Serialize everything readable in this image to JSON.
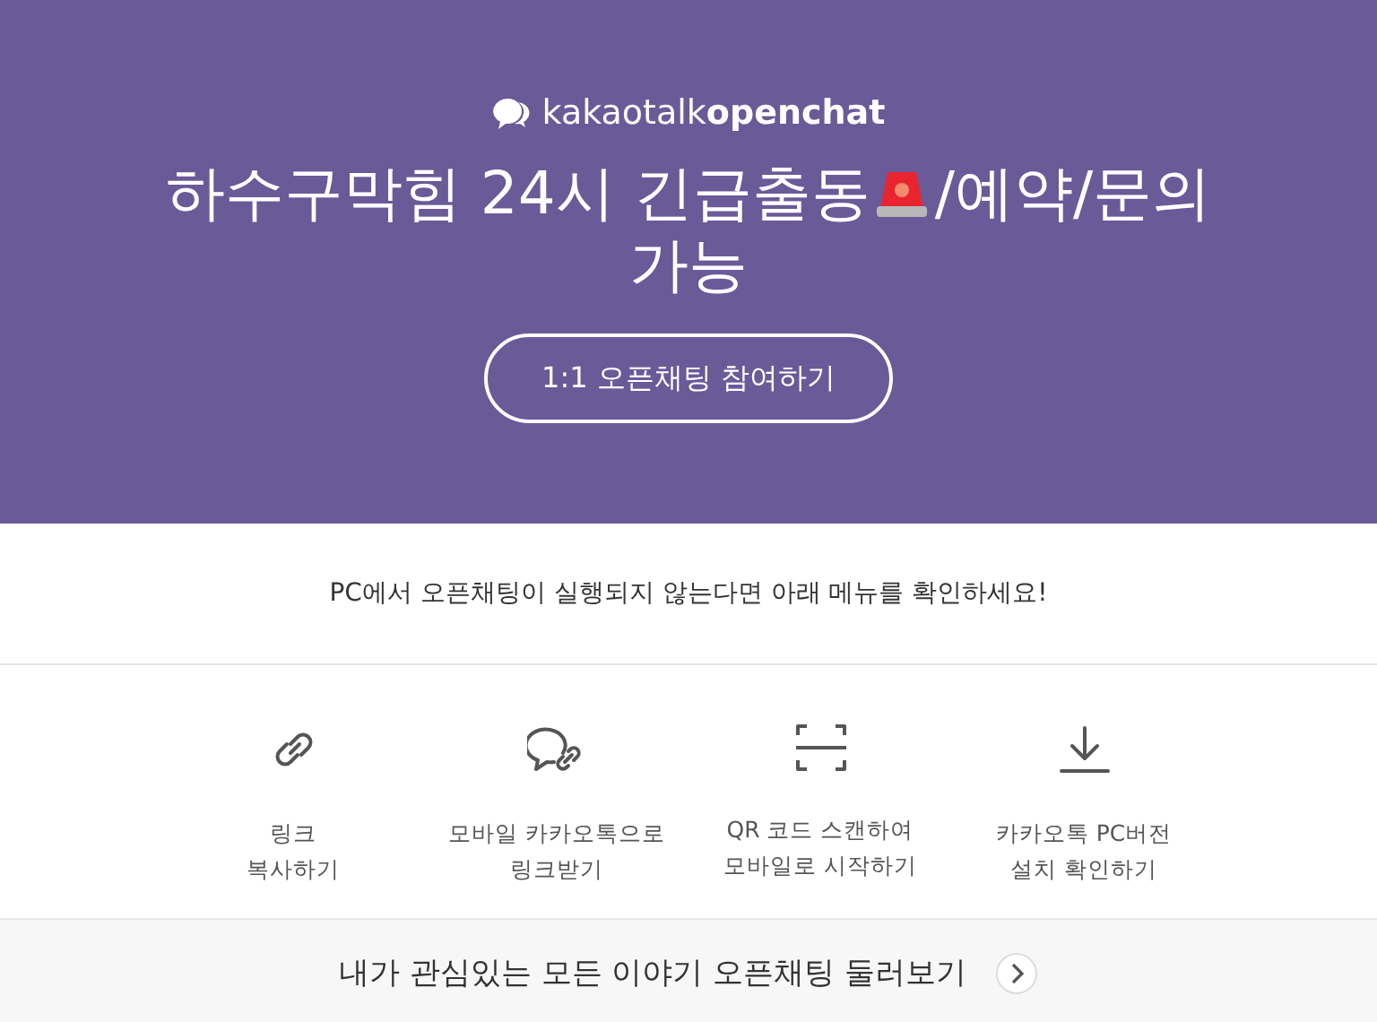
{
  "header": {
    "logo": "kakaotalk**openchat**",
    "title_before": "하수구막힘 24시 긴급출동",
    "title_after": "/예약/문의",
    "title_line2": "가능",
    "join_button": "1:1 오픈채팅 참여하기"
  },
  "notice": "PC에서 오픈채팅이 실행되지 않는다면 아래 메뉴를 확인하세요!",
  "options": [
    {
      "kind": "link",
      "lines": [
        "링크",
        "복사하기"
      ]
    },
    {
      "kind": "chat",
      "lines": [
        "모바일 카카오톡으로",
        "링크받기"
      ]
    },
    {
      "kind": "scan",
      "lines": [
        "QR 코드 스캔하여",
        "모바일로 시작하기"
      ]
    },
    {
      "kind": "download",
      "lines": [
        "카카오톡 PC버전",
        "설치 확인하기"
      ]
    }
  ],
  "browse": {
    "label": "내가 관심있는 모든 이야기 오픈채팅 둘러보기"
  }
}
